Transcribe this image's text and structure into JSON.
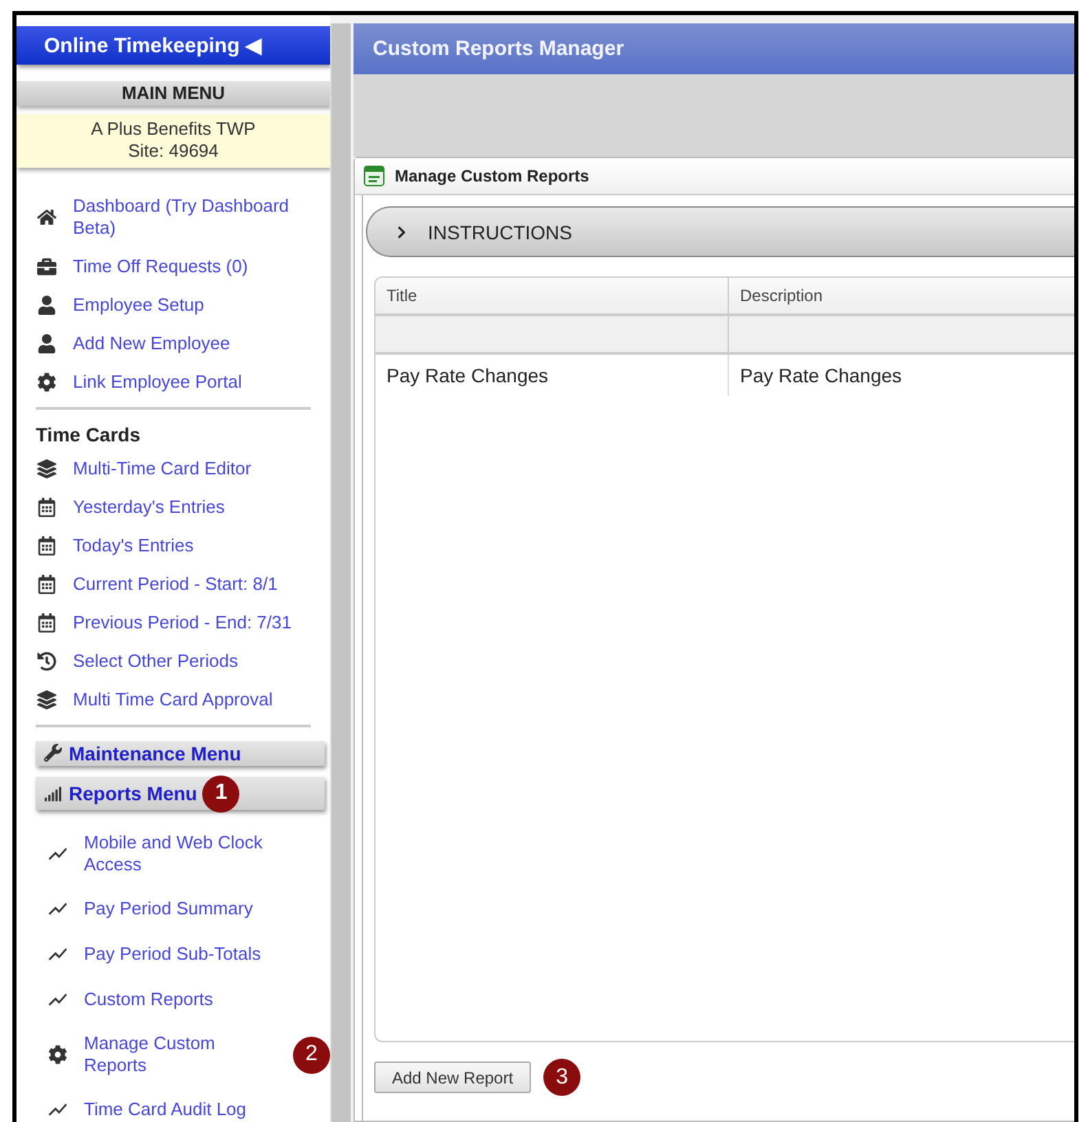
{
  "sidebar": {
    "header": "Online Timekeeping ◀",
    "main_menu": "MAIN MENU",
    "site_lines": [
      "A Plus Benefits TWP",
      "Site: 49694"
    ],
    "main_items": [
      {
        "label": "Dashboard (Try Dashboard Beta)",
        "kind": "home"
      },
      {
        "label": "Time Off Requests (0)",
        "kind": "briefcase"
      },
      {
        "label": "Employee Setup",
        "kind": "user"
      },
      {
        "label": "Add New Employee",
        "kind": "user"
      },
      {
        "label": "Link Employee Portal",
        "kind": "gear"
      }
    ],
    "time_cards": {
      "heading": "Time Cards",
      "items": [
        {
          "label": "Multi-Time Card Editor",
          "kind": "layers"
        },
        {
          "label": "Yesterday's Entries",
          "kind": "calendar"
        },
        {
          "label": "Today's Entries",
          "kind": "calendar"
        },
        {
          "label": "Current Period - Start: 8/1",
          "kind": "calendar"
        },
        {
          "label": "Previous Period - End: 7/31",
          "kind": "calendar"
        },
        {
          "label": "Select Other Periods",
          "kind": "history"
        },
        {
          "label": "Multi Time Card Approval",
          "kind": "layers"
        }
      ]
    },
    "menus": [
      {
        "label": "Maintenance Menu",
        "kind": "wrench"
      },
      {
        "label": "Reports Menu",
        "kind": "bars",
        "badge": "1"
      }
    ],
    "report_items": [
      {
        "label": "Mobile and Web Clock Access",
        "kind": "chart"
      },
      {
        "label": "Pay Period Summary",
        "kind": "chart"
      },
      {
        "label": "Pay Period Sub-Totals",
        "kind": "chart"
      },
      {
        "label": "Custom Reports",
        "kind": "chart"
      },
      {
        "label": "Manage Custom Reports",
        "kind": "gear",
        "badge": "2"
      },
      {
        "label": "Time Card Audit Log",
        "kind": "chart"
      }
    ]
  },
  "main": {
    "title": "Custom Reports Manager",
    "panel_title": "Manage Custom Reports",
    "instructions": {
      "label": "INSTRUCTIONS",
      "expanded": false
    },
    "table": {
      "columns": [
        "Title",
        "Description"
      ],
      "rows": [
        [
          "Pay Rate Changes",
          "Pay Rate Changes"
        ]
      ]
    },
    "add_button": "Add New Report",
    "add_badge": "3"
  }
}
